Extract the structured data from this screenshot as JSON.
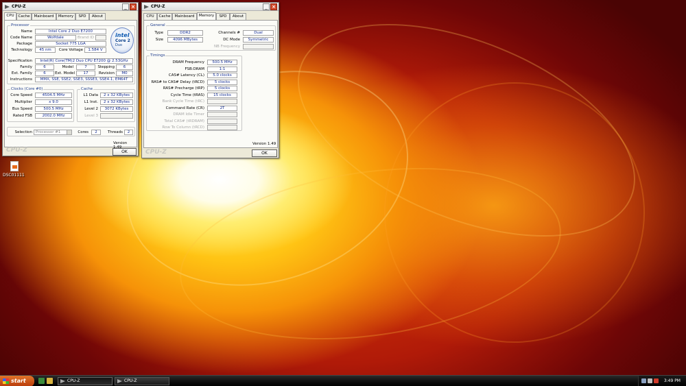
{
  "desktop": {
    "icon_label": "DSC01111"
  },
  "window_cpu": {
    "title": "CPU-Z",
    "tabs": [
      "CPU",
      "Cache",
      "Mainboard",
      "Memory",
      "SPD",
      "About"
    ],
    "active_tab": "CPU",
    "processor_group": "Processor",
    "fields": {
      "name": {
        "label": "Name",
        "value": "Intel Core 2 Duo E7200"
      },
      "code_name": {
        "label": "Code Name",
        "value": "Wolfdale"
      },
      "brand_id": {
        "label": "Brand ID",
        "value": ""
      },
      "package": {
        "label": "Package",
        "value": "Socket 775 LGA"
      },
      "technology": {
        "label": "Technology",
        "value": "45 nm"
      },
      "core_voltage": {
        "label": "Core Voltage",
        "value": "1.584 V"
      },
      "specification": {
        "label": "Specification",
        "value": "Intel(R) Core(TM)2 Duo CPU     E7200  @ 2.53GHz"
      },
      "family": {
        "label": "Family",
        "value": "6"
      },
      "model": {
        "label": "Model",
        "value": "7"
      },
      "stepping": {
        "label": "Stepping",
        "value": "6"
      },
      "ext_family": {
        "label": "Ext. Family",
        "value": "6"
      },
      "ext_model": {
        "label": "Ext. Model",
        "value": "17"
      },
      "revision": {
        "label": "Revision",
        "value": "M0"
      },
      "instructions": {
        "label": "Instructions",
        "value": "MMX, SSE, SSE2, SSE3, SSSE3, SSE4.1, EM64T"
      }
    },
    "intel_logo": {
      "brand": "intel",
      "product": "Core 2",
      "line": "Duo",
      "icon": "intel-core2-duo-logo"
    },
    "clocks_group": "Clocks (Core #0)",
    "clocks": {
      "core_speed": {
        "label": "Core Speed",
        "value": "4504.5 MHz"
      },
      "multiplier": {
        "label": "Multiplier",
        "value": "x 9.0"
      },
      "bus_speed": {
        "label": "Bus Speed",
        "value": "500.5 MHz"
      },
      "rated_fsb": {
        "label": "Rated FSB",
        "value": "2002.0 MHz"
      }
    },
    "cache_group": "Cache",
    "cache": {
      "l1_data": {
        "label": "L1 Data",
        "value": "2 x 32 KBytes"
      },
      "l1_inst": {
        "label": "L1 Inst.",
        "value": "2 x 32 KBytes"
      },
      "level2": {
        "label": "Level 2",
        "value": "3072 KBytes"
      },
      "level3": {
        "label": "Level 3",
        "value": ""
      }
    },
    "selection": {
      "label": "Selection",
      "value": "Processor #1",
      "cores_label": "Cores",
      "cores": "2",
      "threads_label": "Threads",
      "threads": "2"
    },
    "version": "Version 1.49",
    "brand_footer": "CPU-Z",
    "ok_label": "OK"
  },
  "window_mem": {
    "title": "CPU-Z",
    "tabs": [
      "CPU",
      "Cache",
      "Mainboard",
      "Memory",
      "SPD",
      "About"
    ],
    "active_tab": "Memory",
    "general_group": "General",
    "general": {
      "type": {
        "label": "Type",
        "value": "DDR2"
      },
      "size": {
        "label": "Size",
        "value": "4096 MBytes"
      },
      "channels": {
        "label": "Channels #",
        "value": "Dual"
      },
      "dc_mode": {
        "label": "DC Mode",
        "value": "Symmetric"
      },
      "nb_frequency": {
        "label": "NB Frequency",
        "value": ""
      }
    },
    "timings_group": "Timings",
    "timings": [
      {
        "label": "DRAM Frequency",
        "value": "500.5 MHz",
        "enabled": true
      },
      {
        "label": "FSB:DRAM",
        "value": "1:1",
        "enabled": true
      },
      {
        "label": "CAS# Latency (CL)",
        "value": "5.0 clocks",
        "enabled": true
      },
      {
        "label": "RAS# to CAS# Delay (tRCD)",
        "value": "5 clocks",
        "enabled": true
      },
      {
        "label": "RAS# Precharge (tRP)",
        "value": "5 clocks",
        "enabled": true
      },
      {
        "label": "Cycle Time (tRAS)",
        "value": "15 clocks",
        "enabled": true
      },
      {
        "label": "Bank Cycle Time (tRC)",
        "value": "",
        "enabled": false
      },
      {
        "label": "Command Rate (CR)",
        "value": "2T",
        "enabled": true
      },
      {
        "label": "DRAM Idle Timer",
        "value": "",
        "enabled": false
      },
      {
        "label": "Total CAS# (tRDRAM)",
        "value": "",
        "enabled": false
      },
      {
        "label": "Row To Column (tRCD)",
        "value": "",
        "enabled": false
      }
    ],
    "version": "Version 1.49",
    "brand_footer": "CPU-Z",
    "ok_label": "OK"
  },
  "taskbar": {
    "start_label": "start",
    "tasks": [
      {
        "label": "CPU-Z",
        "active": true
      },
      {
        "label": "CPU-Z",
        "active": false
      }
    ],
    "clock": "3:49 PM"
  }
}
